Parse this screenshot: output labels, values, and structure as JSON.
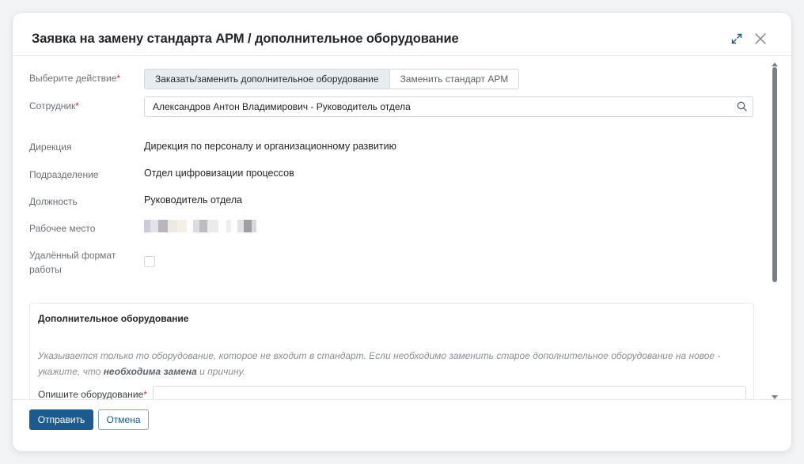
{
  "dialog": {
    "title": "Заявка на замену стандарта АРМ / дополнительное оборудование"
  },
  "form": {
    "action": {
      "label": "Выберите действие",
      "required_mark": "*",
      "options": [
        "Заказать/заменить дополнительное оборудование",
        "Заменить стандарт АРМ"
      ],
      "selected": "Заказать/заменить дополнительное оборудование"
    },
    "employee": {
      "label": "Сотрудник",
      "required_mark": "*",
      "value": "Александров Антон Владимирович - Руководитель отдела"
    },
    "directorate": {
      "label": "Дирекция",
      "value": "Дирекция по персоналу и организационному развитию"
    },
    "department": {
      "label": "Подразделение",
      "value": "Отдел цифровизации процессов"
    },
    "position": {
      "label": "Должность",
      "value": "Руководитель отдела"
    },
    "workplace": {
      "label": "Рабочее место"
    },
    "remote": {
      "label_line1": "Удалённый формат",
      "label_line2": "работы",
      "checked": false
    }
  },
  "equipment_section": {
    "title": "Дополнительное оборудование",
    "hint_part1": "Указывается только то оборудование, которое не входит в стандарт. Если необходимо заменить старое дополнительное оборудование на новое - укажите, что ",
    "hint_bold": "необходима замена",
    "hint_part2": " и причину.",
    "describe_label": "Опишите оборудование",
    "required_mark": "*",
    "describe_value": ""
  },
  "footer": {
    "submit_label": "Отправить",
    "cancel_label": "Отмена"
  },
  "colors": {
    "primary": "#1d5a8e",
    "required": "#d0312d",
    "segment_active_bg": "#e7ecf1"
  },
  "icons": {
    "expand": "expand-icon",
    "close": "close-icon",
    "search": "search-icon",
    "scroll_up": "arrow-up-icon",
    "scroll_down": "arrow-down-icon"
  }
}
